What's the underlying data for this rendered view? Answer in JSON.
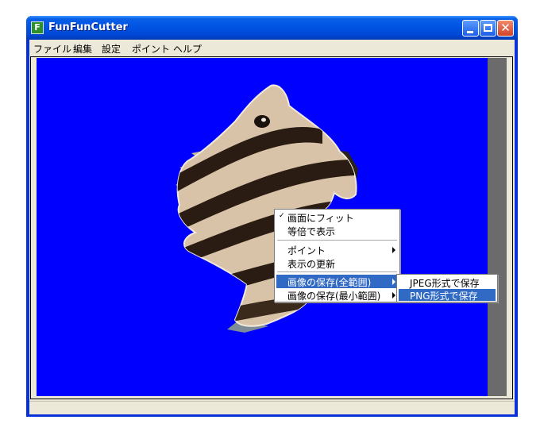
{
  "window": {
    "title": "FunFunCutter",
    "icon_letter": "F",
    "close_glyph": "✕"
  },
  "menubar": [
    "ファイル",
    "編集",
    "設定",
    "ポイント",
    "ヘルプ"
  ],
  "context_menu": {
    "fit_check": "✓",
    "fit": "画面にフィット",
    "actual_size": "等倍で表示",
    "point": "ポイント",
    "refresh": "表示の更新",
    "save_full": "画像の保存(全範囲)",
    "save_min": "画像の保存(最小範囲)"
  },
  "submenu": {
    "jpeg": "JPEG形式で保存",
    "png": "PNG形式で保存"
  },
  "colors": {
    "canvas": "#0000ff",
    "highlight": "#316ac5"
  }
}
